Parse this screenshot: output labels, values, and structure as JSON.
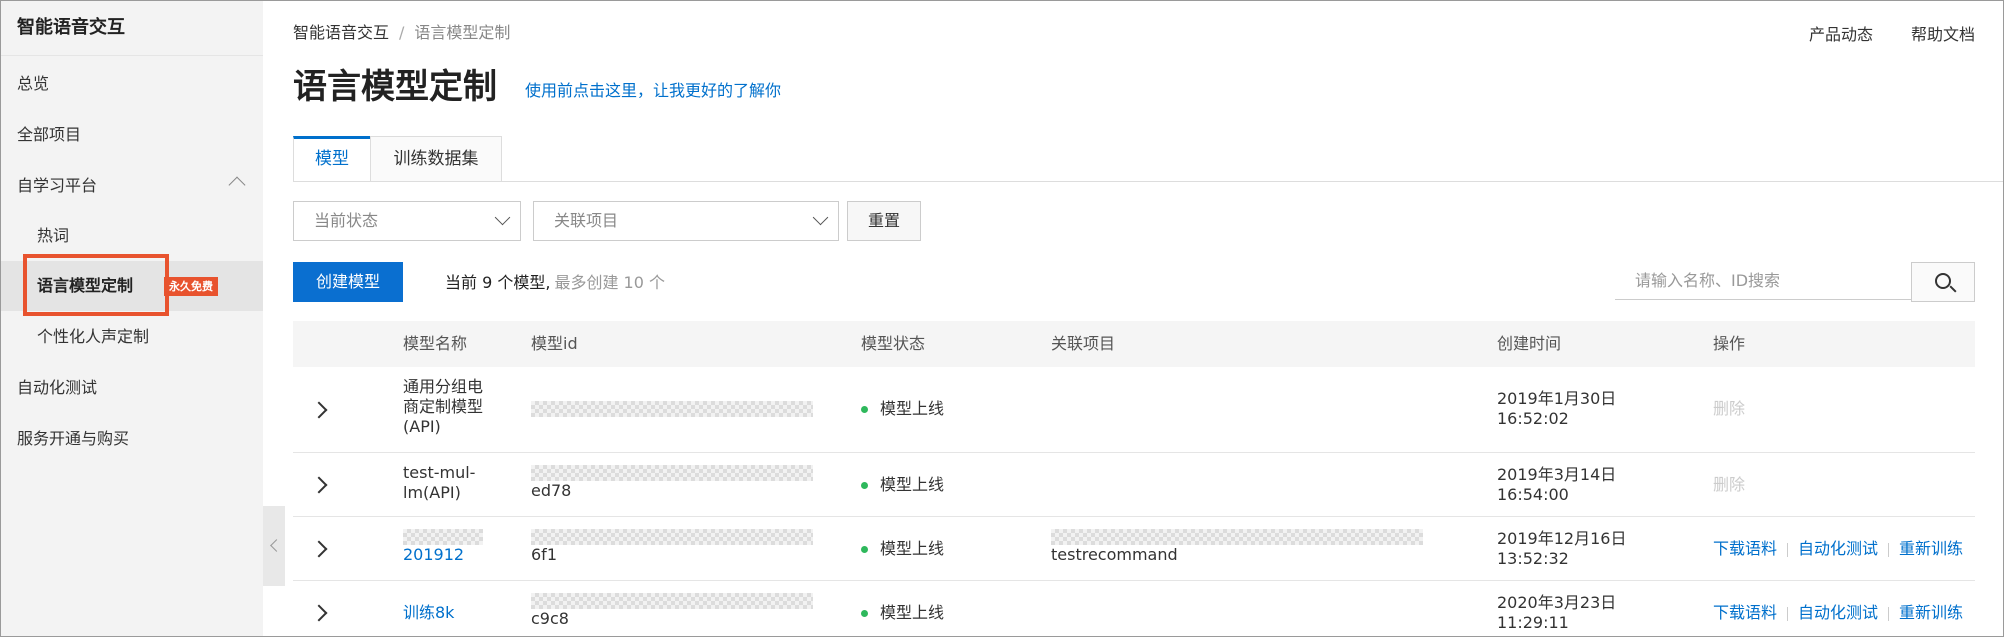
{
  "sidebar": {
    "title": "智能语音交互",
    "items": [
      {
        "label": "总览"
      },
      {
        "label": "全部项目"
      },
      {
        "label": "自学习平台"
      },
      {
        "label": "热词"
      },
      {
        "label": "语言模型定制"
      },
      {
        "label": "个性化人声定制"
      },
      {
        "label": "自动化测试"
      },
      {
        "label": "服务开通与购买"
      }
    ],
    "badge": "永久免费"
  },
  "header": {
    "breadcrumb": [
      "智能语音交互",
      "语言模型定制"
    ],
    "links": [
      "产品动态",
      "帮助文档"
    ],
    "title": "语言模型定制",
    "intro_link": "使用前点击这里，让我更好的了解你"
  },
  "tabs": [
    {
      "label": "模型",
      "active": true
    },
    {
      "label": "训练数据集",
      "active": false
    }
  ],
  "filters": {
    "status_placeholder": "当前状态",
    "project_placeholder": "关联项目",
    "reset_label": "重置"
  },
  "toolbar": {
    "create_label": "创建模型",
    "count_text": "当前 9 个模型,",
    "max_text": "最多创建 10 个",
    "search_placeholder": "请输入名称、ID搜索"
  },
  "table": {
    "columns": [
      "模型名称",
      "模型id",
      "模型状态",
      "关联项目",
      "创建时间",
      "操作"
    ],
    "rows": [
      {
        "name": "通用分组电商定制模型(API)",
        "id_suffix": "",
        "status": "模型上线",
        "project": "",
        "created": "2019年1月30日 16:52:02",
        "ops": [
          "删除"
        ],
        "ops_disabled": true
      },
      {
        "name": "test-mul-lm(API)",
        "id_suffix": "ed78",
        "status": "模型上线",
        "project": "",
        "created": "2019年3月14日 16:54:00",
        "ops": [
          "删除"
        ],
        "ops_disabled": true
      },
      {
        "name": "201912",
        "id_suffix": "6f1",
        "status": "模型上线",
        "project": "testrecommand",
        "created": "2019年12月16日 13:52:32",
        "ops": [
          "下载语料",
          "自动化测试",
          "重新训练"
        ],
        "ops_disabled": false
      },
      {
        "name": "训练8k",
        "id_suffix": "c9c8",
        "status": "模型上线",
        "project": "",
        "created": "2020年3月23日 11:29:11",
        "ops": [
          "下载语料",
          "自动化测试",
          "重新训练"
        ],
        "ops_disabled": false
      }
    ]
  },
  "colors": {
    "accent": "#0070cc",
    "highlight": "#e8532e",
    "status_online": "#2eb85c"
  }
}
